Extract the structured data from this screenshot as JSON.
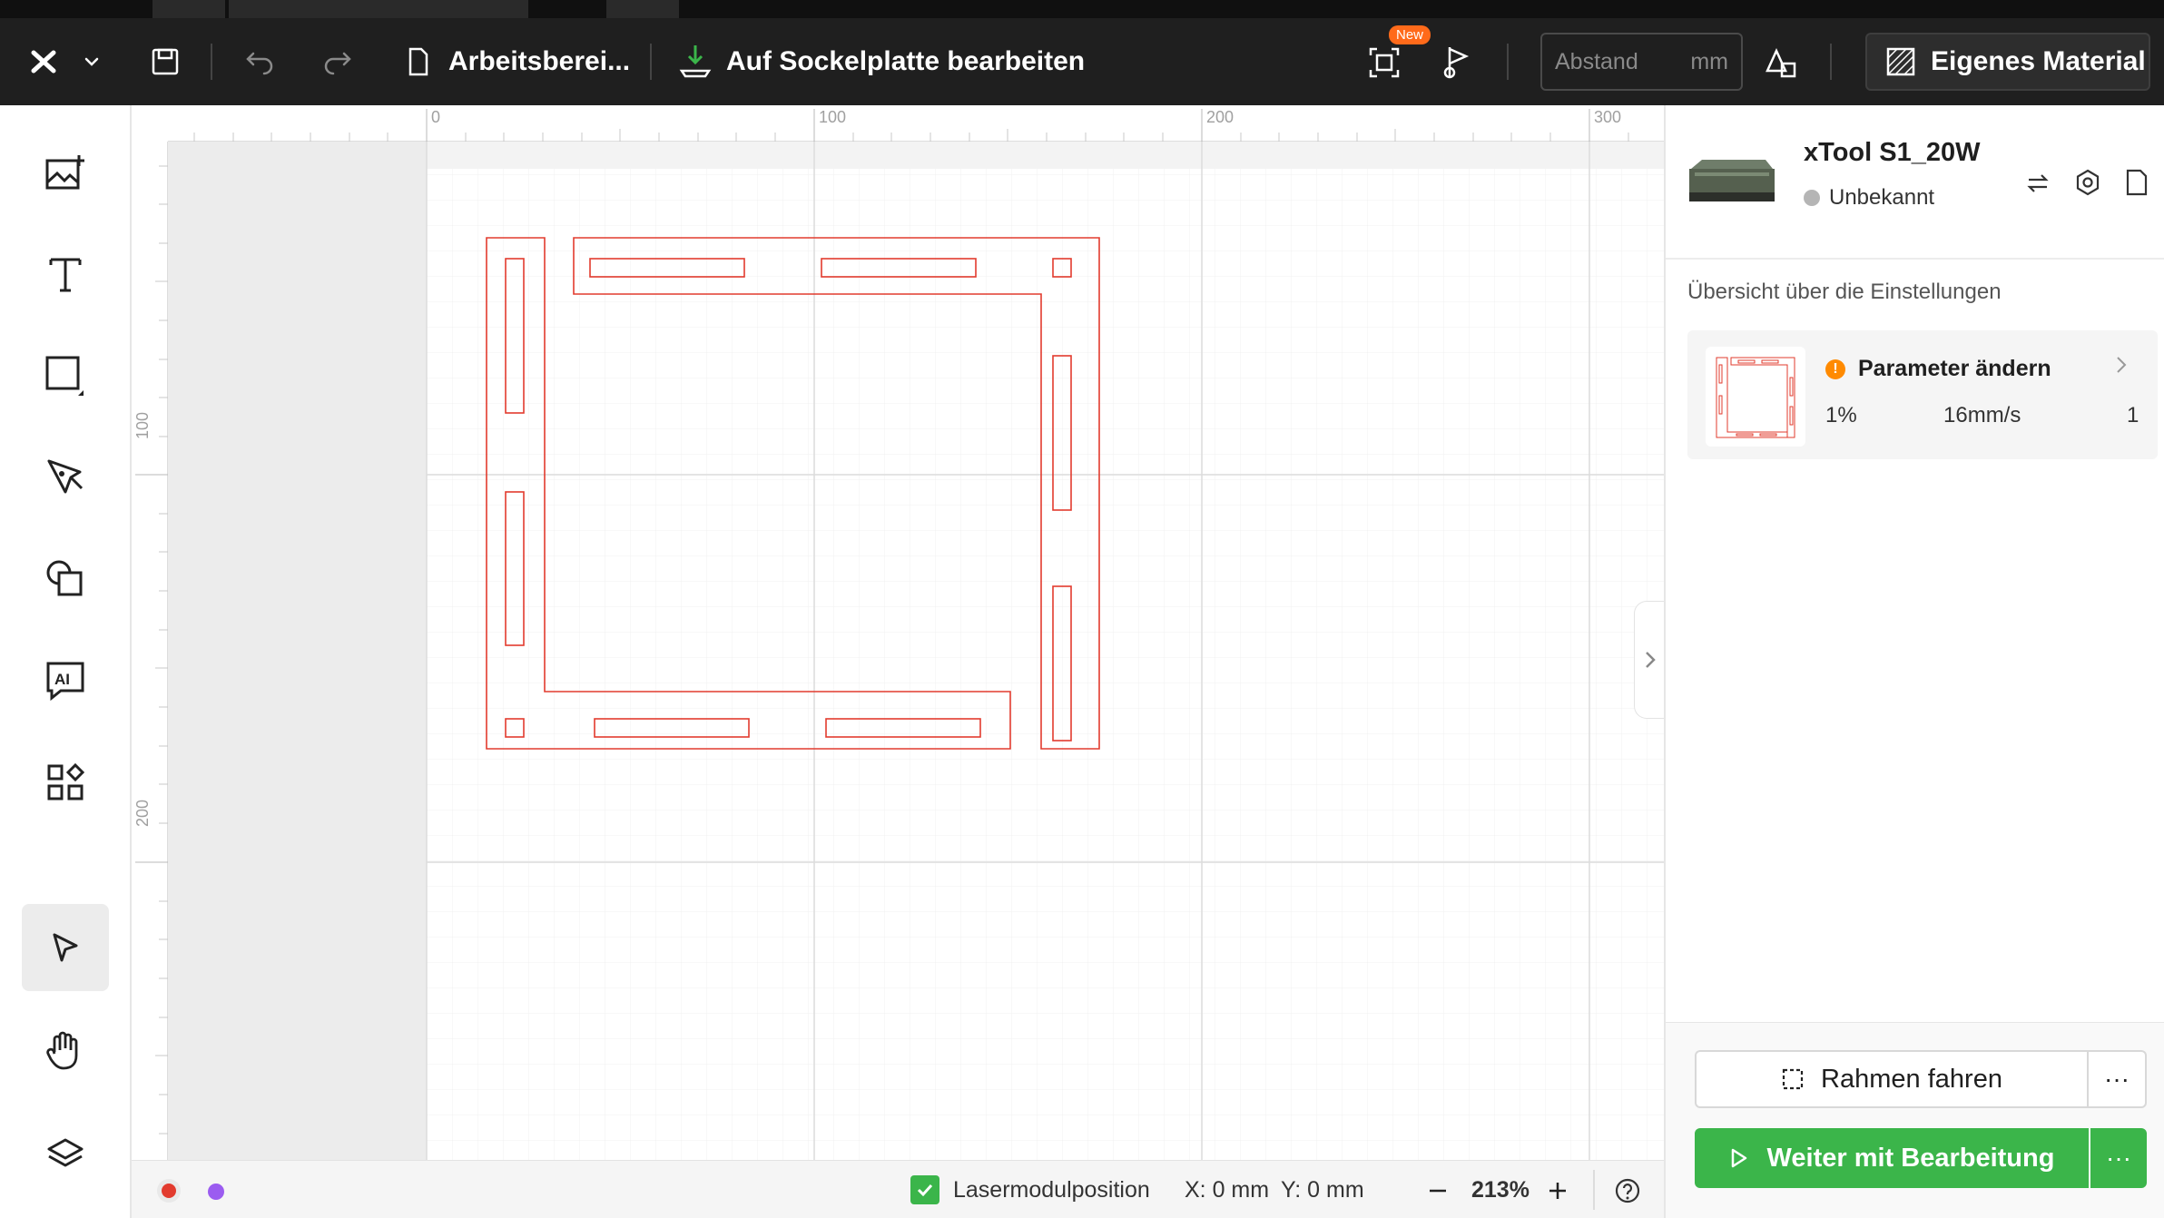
{
  "header": {
    "project_title": "Arbeitsberei...",
    "mode_label": "Auf Sockelplatte bearbeiten",
    "new_badge": "New",
    "spacing_placeholder": "Abstand",
    "spacing_unit": "mm",
    "material_label": "Eigenes Material"
  },
  "toolbar": {
    "tools": [
      "image-add",
      "text",
      "shape-rectangle",
      "pen",
      "shapes",
      "ai",
      "apps",
      "select",
      "hand",
      "layers"
    ],
    "active_tool": "select"
  },
  "rulers": {
    "top_labels": [
      "0",
      "100",
      "200",
      "300"
    ],
    "left_labels": [
      "100",
      "200"
    ]
  },
  "statusbar": {
    "layer_colors": [
      "#e23b2e",
      "#9b5cf0"
    ],
    "laser_position_label": "Lasermodulposition",
    "laser_position_checked": true,
    "x_readout": "X: 0 mm",
    "y_readout": "Y: 0 mm",
    "zoom": "213%"
  },
  "device": {
    "name": "xTool S1_20W",
    "status": "Unbekannt"
  },
  "settings": {
    "overview_title": "Übersicht über die Einstellungen",
    "param_title": "Parameter ändern",
    "power": "1%",
    "speed": "16mm/s",
    "passes": "1"
  },
  "actions": {
    "frame_label": "Rahmen fahren",
    "continue_label": "Weiter mit Bearbeitung",
    "more": "···"
  },
  "colors": {
    "accent_green": "#3bb54a",
    "cut_red": "#e23b2e",
    "header_bg": "#1f1f1f"
  }
}
